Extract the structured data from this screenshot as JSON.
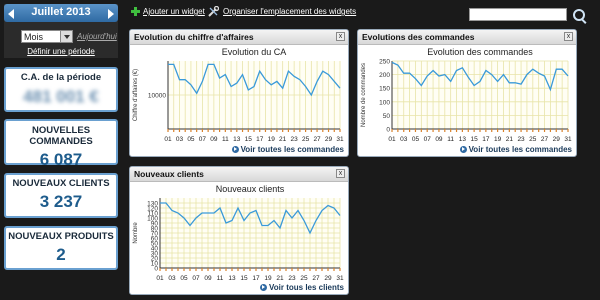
{
  "calendar": {
    "month_title": "Juillet 2013",
    "period_select": "Mois",
    "today_link": "Aujourd'hui",
    "define_period": "Définir une période"
  },
  "stats": [
    {
      "label": "C.A. de la période",
      "value": "481 001 €"
    },
    {
      "label": "NOUVELLES COMMANDES",
      "value": "6 087"
    },
    {
      "label": "NOUVEAUX CLIENTS",
      "value": "3 237"
    },
    {
      "label": "NOUVEAUX PRODUITS",
      "value": "2"
    }
  ],
  "toolbar": {
    "add_widget": "Ajouter un widget",
    "organize_widgets": "Organiser l'emplacement des widgets",
    "search_placeholder": ""
  },
  "widgets": {
    "ca": {
      "title": "Evolution du chiffre d'affaires",
      "footer": "Voir toutes les commandes"
    },
    "commandes": {
      "title": "Evolutions des commandes",
      "footer": "Voir toutes les commandes"
    },
    "clients": {
      "title": "Nouveaux clients",
      "footer": "Voir tous les clients"
    }
  },
  "colors": {
    "line": "#3a9ad9",
    "grid": "#e8e4a8",
    "accent": "#1e5c8c"
  },
  "chart_data": [
    {
      "type": "line",
      "title": "Evolution du CA",
      "ylabel": "Chiffre d'affaires (€)",
      "xlabel": "",
      "x": [
        1,
        2,
        3,
        4,
        5,
        6,
        7,
        8,
        9,
        10,
        11,
        12,
        13,
        14,
        15,
        16,
        17,
        18,
        19,
        20,
        21,
        22,
        23,
        24,
        25,
        26,
        27,
        28,
        29,
        30,
        31
      ],
      "xticks": [
        "01",
        "03",
        "05",
        "07",
        "09",
        "11",
        "13",
        "15",
        "17",
        "19",
        "21",
        "23",
        "25",
        "27",
        "29",
        "31"
      ],
      "values": [
        19000,
        19000,
        14500,
        14500,
        13000,
        10500,
        14000,
        19000,
        19000,
        15000,
        16000,
        12500,
        13500,
        16000,
        11500,
        12500,
        17000,
        14500,
        13000,
        14000,
        12000,
        17000,
        15500,
        14500,
        12500,
        10000,
        14000,
        17000,
        16000,
        14000,
        12000
      ],
      "ylim": [
        0,
        20000
      ],
      "yticks": [
        10000
      ],
      "grid": true
    },
    {
      "type": "line",
      "title": "Evolution des commandes",
      "ylabel": "Nombre de commandes",
      "xlabel": "",
      "x": [
        1,
        2,
        3,
        4,
        5,
        6,
        7,
        8,
        9,
        10,
        11,
        12,
        13,
        14,
        15,
        16,
        17,
        18,
        19,
        20,
        21,
        22,
        23,
        24,
        25,
        26,
        27,
        28,
        29,
        30,
        31
      ],
      "xticks": [
        "01",
        "03",
        "05",
        "07",
        "09",
        "11",
        "13",
        "15",
        "17",
        "19",
        "21",
        "23",
        "25",
        "27",
        "29",
        "31"
      ],
      "values": [
        245,
        235,
        205,
        205,
        185,
        160,
        195,
        215,
        195,
        200,
        175,
        215,
        225,
        190,
        160,
        175,
        215,
        200,
        175,
        200,
        170,
        170,
        165,
        200,
        220,
        205,
        195,
        145,
        220,
        220,
        195
      ],
      "ylim": [
        0,
        250
      ],
      "yticks": [
        0,
        50,
        100,
        150,
        200,
        250
      ],
      "grid": true
    },
    {
      "type": "line",
      "title": "Nouveaux clients",
      "ylabel": "Nombre",
      "xlabel": "",
      "x": [
        1,
        2,
        3,
        4,
        5,
        6,
        7,
        8,
        9,
        10,
        11,
        12,
        13,
        14,
        15,
        16,
        17,
        18,
        19,
        20,
        21,
        22,
        23,
        24,
        25,
        26,
        27,
        28,
        29,
        30,
        31
      ],
      "xticks": [
        "01",
        "03",
        "05",
        "07",
        "09",
        "11",
        "13",
        "15",
        "17",
        "19",
        "21",
        "23",
        "25",
        "27",
        "29",
        "31"
      ],
      "values": [
        130,
        130,
        115,
        110,
        100,
        85,
        100,
        110,
        110,
        110,
        120,
        90,
        95,
        120,
        95,
        110,
        115,
        85,
        85,
        95,
        80,
        115,
        100,
        115,
        95,
        70,
        95,
        115,
        125,
        120,
        105
      ],
      "ylim": [
        0,
        140
      ],
      "yticks": [
        0,
        10,
        20,
        30,
        40,
        50,
        60,
        70,
        80,
        90,
        100,
        110,
        120,
        130
      ],
      "grid": true
    }
  ]
}
